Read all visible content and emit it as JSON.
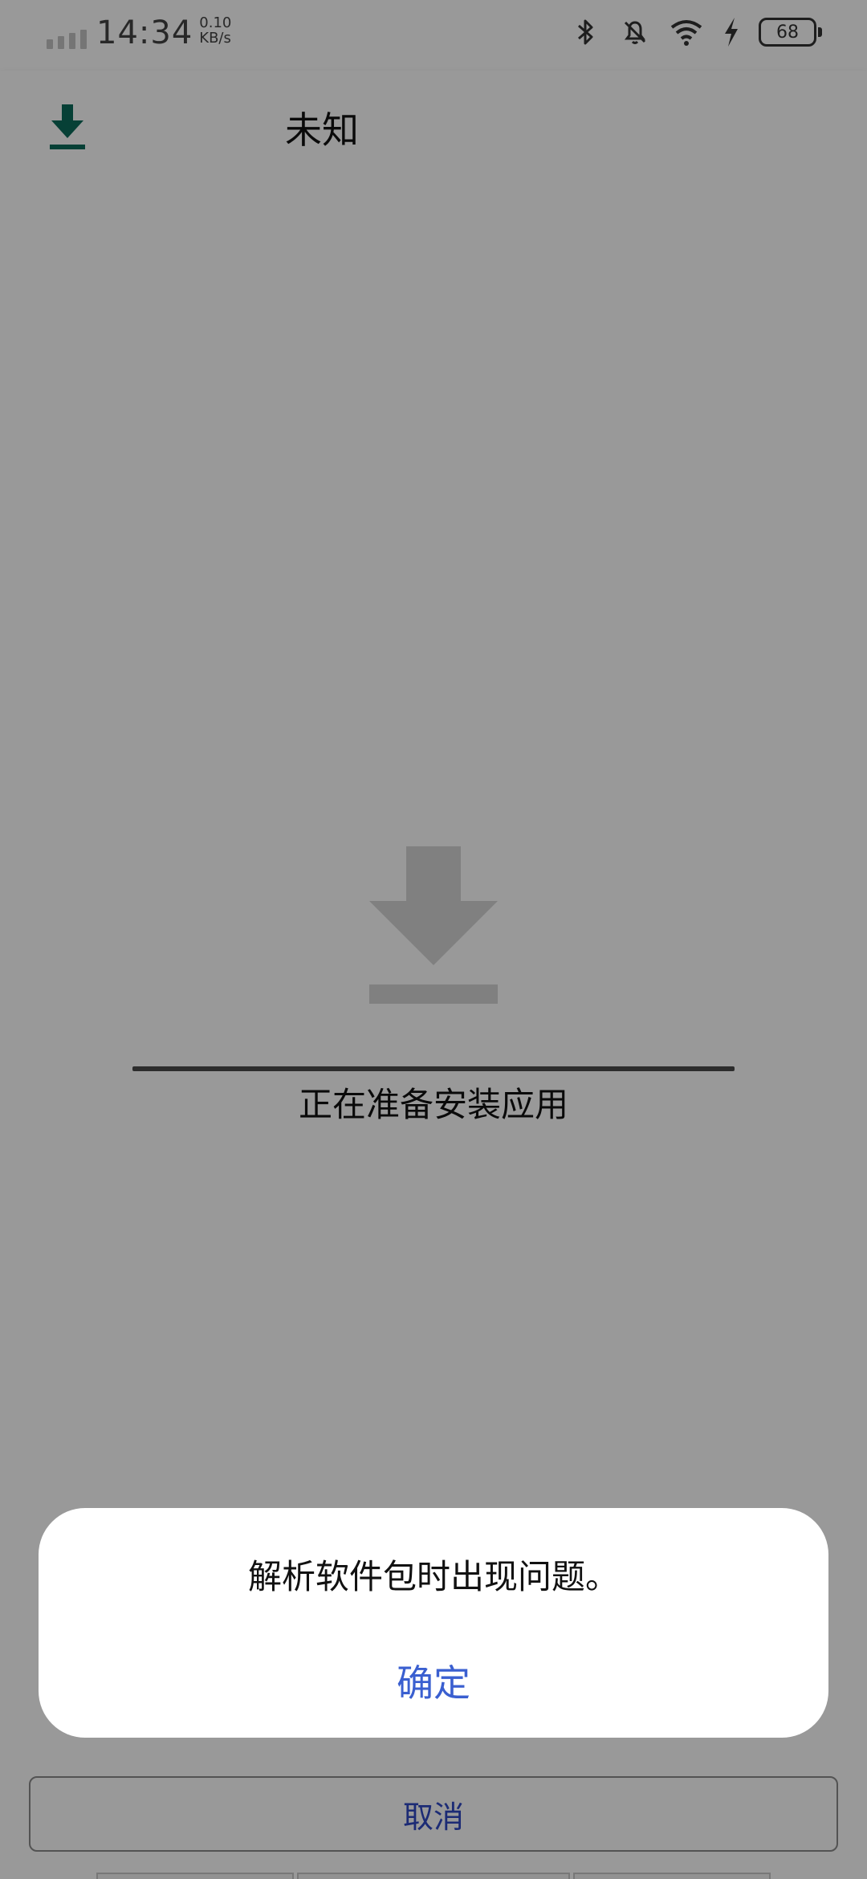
{
  "status_bar": {
    "time": "14:34",
    "net_speed_value": "0.10",
    "net_speed_unit": "KB/s",
    "battery_level": "68"
  },
  "app_bar": {
    "title": "未知",
    "icon": "download-icon"
  },
  "content": {
    "icon": "download-icon",
    "status_text": "正在准备安装应用"
  },
  "dialog": {
    "message": "解析软件包时出现问题。",
    "ok_label": "确定"
  },
  "bottom": {
    "cancel_label": "取消"
  },
  "colors": {
    "accent_blue": "#3a5fd0",
    "cancel_blue": "#3049c4",
    "icon_green": "#0b6b5a",
    "icon_gray": "#d6d6d6"
  }
}
